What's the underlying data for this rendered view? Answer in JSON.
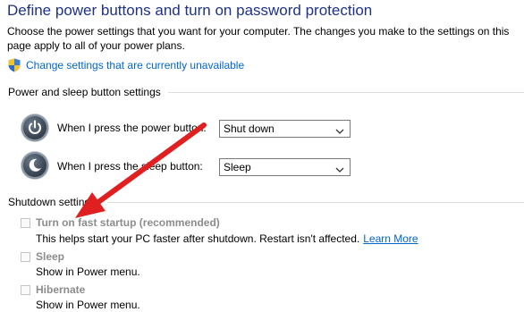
{
  "header": {
    "title": "Define power buttons and turn on password protection",
    "intro": "Choose the power settings that you want for your computer. The changes you make to the settings on this page apply to all of your power plans.",
    "change_link": "Change settings that are currently unavailable"
  },
  "power_sleep": {
    "group_label": "Power and sleep button settings",
    "power_row": {
      "label": "When I press the power button:",
      "selected": "Shut down"
    },
    "sleep_row": {
      "label": "When I press the sleep button:",
      "selected": "Sleep"
    }
  },
  "shutdown": {
    "group_label": "Shutdown settings",
    "items": [
      {
        "label": "Turn on fast startup (recommended)",
        "description": "This helps start your PC faster after shutdown. Restart isn't affected.",
        "link": "Learn More",
        "checked": false
      },
      {
        "label": "Sleep",
        "description": "Show in Power menu.",
        "checked": false
      },
      {
        "label": "Hibernate",
        "description": "Show in Power menu.",
        "checked": false
      }
    ]
  },
  "colors": {
    "title": "#1e3287",
    "link": "#0066cc",
    "disabled_text": "#8c8c8c",
    "annotation_arrow": "#e02020"
  },
  "icons": {
    "shield": "uac-shield-icon",
    "power": "power-button-icon",
    "sleep": "sleep-moon-icon",
    "dropdown": "chevron-down-icon"
  }
}
